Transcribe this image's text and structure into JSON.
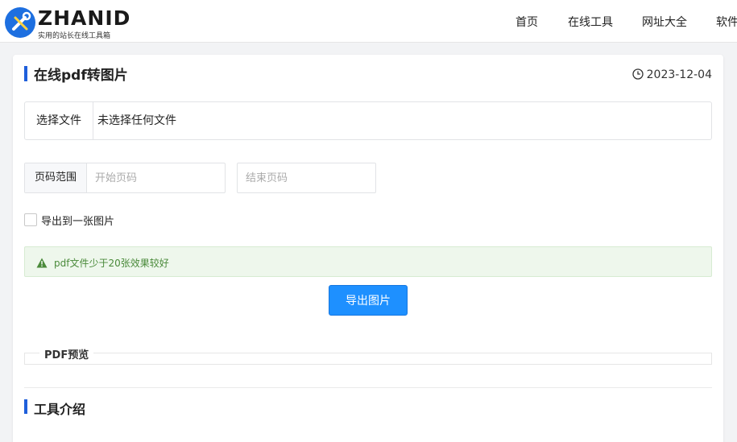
{
  "header": {
    "logo_word": "ZHANID",
    "logo_tagline": "实用的站长在线工具箱",
    "nav": [
      "首页",
      "在线工具",
      "网址大全",
      "软件"
    ]
  },
  "tool": {
    "title": "在线pdf转图片",
    "date": "2023-12-04",
    "file": {
      "button_label": "选择文件",
      "status": "未选择任何文件"
    },
    "page_range": {
      "label": "页码范围",
      "start_placeholder": "开始页码",
      "end_placeholder": "结束页码"
    },
    "single_image": {
      "label": "导出到一张图片",
      "checked": false
    },
    "tip": "pdf文件少于20张效果较好",
    "export_label": "导出图片",
    "preview_label": "PDF预览"
  },
  "intro": {
    "title": "工具介绍"
  },
  "colors": {
    "accent": "#1f5fdb",
    "button": "#1e90ff",
    "tip_bg": "#eef7ec",
    "tip_text": "#4a8a3a"
  },
  "icons": {
    "logo": "wrench-screwdriver-icon",
    "date": "clock-icon",
    "tip": "warning-triangle-icon"
  }
}
